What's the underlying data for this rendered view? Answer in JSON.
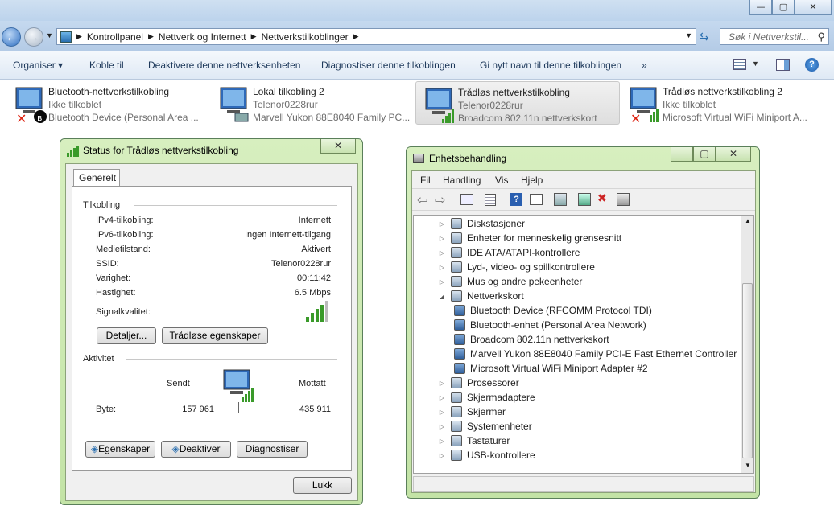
{
  "window": {
    "minimize": "—",
    "maximize": "▢",
    "close": "✕"
  },
  "address": {
    "crumbs": [
      "Kontrollpanel",
      "Nettverk og Internett",
      "Nettverkstilkoblinger"
    ],
    "search_placeholder": "Søk i Nettverkstil..."
  },
  "toolbar": {
    "items": [
      "Organiser ▾",
      "Koble til",
      "Deaktivere denne nettverksenheten",
      "Diagnostiser denne tilkoblingen",
      "Gi nytt navn til denne tilkoblingen",
      "»"
    ]
  },
  "connections": [
    {
      "name": "Bluetooth-nettverkstilkobling",
      "status": "Ikke tilkoblet",
      "device": "Bluetooth Device (Personal Area ..."
    },
    {
      "name": "Lokal tilkobling 2",
      "status": "Telenor0228rur",
      "device": "Marvell Yukon 88E8040 Family PC..."
    },
    {
      "name": "Trådløs nettverkstilkobling",
      "status": "Telenor0228rur",
      "device": "Broadcom 802.11n nettverkskort"
    },
    {
      "name": "Trådløs nettverkstilkobling 2",
      "status": "Ikke tilkoblet",
      "device": "Microsoft Virtual WiFi Miniport A..."
    }
  ],
  "status_dialog": {
    "title": "Status for Trådløs nettverkstilkobling",
    "tab": "Generelt",
    "section_connection": "Tilkobling",
    "rows": [
      {
        "label": "IPv4-tilkobling:",
        "value": "Internett"
      },
      {
        "label": "IPv6-tilkobling:",
        "value": "Ingen Internett-tilgang"
      },
      {
        "label": "Medietilstand:",
        "value": "Aktivert"
      },
      {
        "label": "SSID:",
        "value": "Telenor0228rur"
      },
      {
        "label": "Varighet:",
        "value": "00:11:42"
      },
      {
        "label": "Hastighet:",
        "value": "6.5 Mbps"
      }
    ],
    "signal_label": "Signalkvalitet:",
    "signal_level": 0.8,
    "details_btn": "Detaljer...",
    "wireless_btn": "Trådløse egenskaper",
    "section_activity": "Aktivitet",
    "sent": "Sendt",
    "received": "Mottatt",
    "bytes_label": "Byte:",
    "bytes_sent": "157 961",
    "bytes_received": "435 911",
    "properties_btn": "Egenskaper",
    "disable_btn": "Deaktiver",
    "diagnose_btn": "Diagnostiser",
    "close_btn": "Lukk"
  },
  "devmgr": {
    "title": "Enhetsbehandling",
    "menu": [
      "Fil",
      "Handling",
      "Vis",
      "Hjelp"
    ],
    "tree": [
      {
        "label": "Diskstasjoner",
        "level": 0,
        "exp": "▷"
      },
      {
        "label": "Enheter for menneskelig grensesnitt",
        "level": 0,
        "exp": "▷"
      },
      {
        "label": "IDE ATA/ATAPI-kontrollere",
        "level": 0,
        "exp": "▷"
      },
      {
        "label": "Lyd-, video- og spillkontrollere",
        "level": 0,
        "exp": "▷"
      },
      {
        "label": "Mus og andre pekeenheter",
        "level": 0,
        "exp": "▷"
      },
      {
        "label": "Nettverkskort",
        "level": 0,
        "exp": "◢"
      },
      {
        "label": "Bluetooth Device (RFCOMM Protocol TDI)",
        "level": 1,
        "exp": ""
      },
      {
        "label": "Bluetooth-enhet (Personal Area Network)",
        "level": 1,
        "exp": ""
      },
      {
        "label": "Broadcom 802.11n nettverkskort",
        "level": 1,
        "exp": ""
      },
      {
        "label": "Marvell Yukon 88E8040 Family PCI-E Fast Ethernet Controller",
        "level": 1,
        "exp": ""
      },
      {
        "label": "Microsoft Virtual WiFi Miniport Adapter #2",
        "level": 1,
        "exp": ""
      },
      {
        "label": "Prosessorer",
        "level": 0,
        "exp": "▷"
      },
      {
        "label": "Skjermadaptere",
        "level": 0,
        "exp": "▷"
      },
      {
        "label": "Skjermer",
        "level": 0,
        "exp": "▷"
      },
      {
        "label": "Systemenheter",
        "level": 0,
        "exp": "▷"
      },
      {
        "label": "Tastaturer",
        "level": 0,
        "exp": "▷"
      },
      {
        "label": "USB-kontrollere",
        "level": 0,
        "exp": "▷"
      }
    ]
  }
}
